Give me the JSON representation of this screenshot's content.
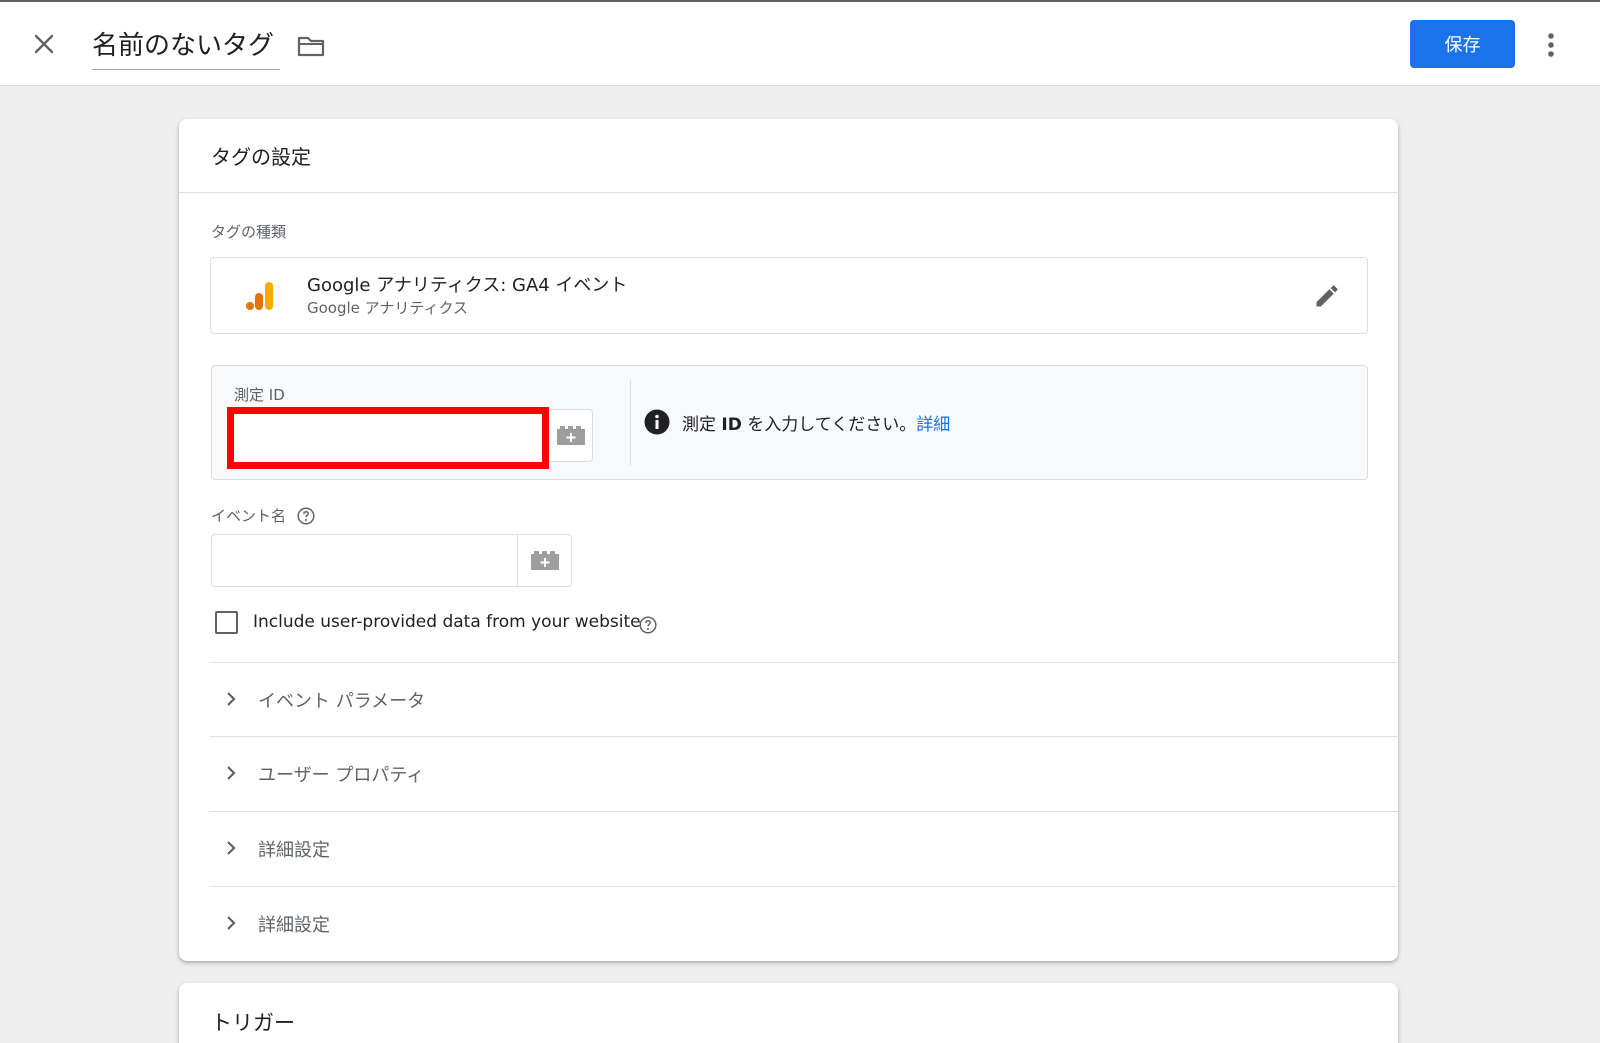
{
  "header": {
    "close_icon": "close-icon",
    "tag_name": "名前のないタグ",
    "folder_icon": "folder-icon",
    "save_label": "保存",
    "more_icon": "more-vert-icon",
    "accent_color": "#1a73e8"
  },
  "tag_config": {
    "title": "タグの設定",
    "tag_type_label": "タグの種類",
    "tag_type": {
      "icon": "google-analytics-icon",
      "name": "Google アナリティクス: GA4 イベント",
      "provider": "Google アナリティクス",
      "edit_icon": "pencil-icon"
    },
    "measurement_id": {
      "label": "測定 ID",
      "value": "",
      "highlight_color": "#ff0000",
      "variable_icon": "add-variable-icon",
      "info_prefix": "測定 ",
      "info_bold": "ID",
      "info_suffix": " を入力してください。",
      "info_link": "詳細"
    },
    "event_name": {
      "label": "イベント名",
      "value": "",
      "help_icon": "help-icon",
      "variable_icon": "add-variable-icon"
    },
    "user_data_checkbox": {
      "label": "Include user-provided data from your website",
      "checked": false,
      "help_icon": "help-icon"
    },
    "sections": [
      {
        "label": "イベント パラメータ"
      },
      {
        "label": "ユーザー プロパティ"
      },
      {
        "label": "詳細設定"
      },
      {
        "label": "詳細設定"
      }
    ]
  },
  "trigger": {
    "title": "トリガー"
  }
}
